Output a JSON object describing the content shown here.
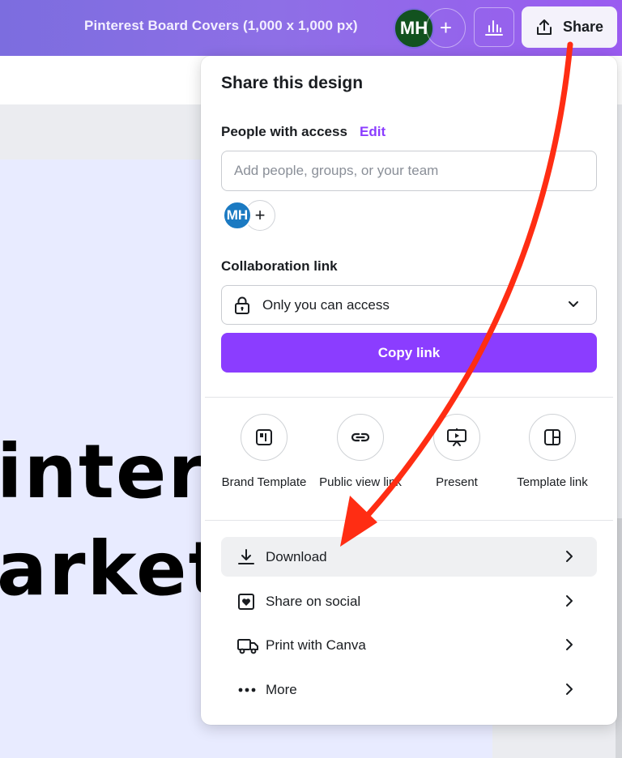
{
  "topbar": {
    "doc_title": "Pinterest Board Covers (1,000 x 1,000 px)",
    "avatar_initials": "MH",
    "add_symbol": "+",
    "share_label": "Share",
    "icons": [
      "plus-icon",
      "insights-chart-icon",
      "share-upload-icon"
    ]
  },
  "canvas": {
    "text_line_1": "intere",
    "text_line_2": "arket"
  },
  "share_panel": {
    "title": "Share this design",
    "people_label": "People with access",
    "edit_label": "Edit",
    "people_placeholder": "Add people, groups, or your team",
    "member_initials": "MH",
    "add_member_symbol": "+",
    "collab_label": "Collaboration link",
    "access_value": "Only you can access",
    "copy_label": "Copy link",
    "options": [
      {
        "label": "Brand Template",
        "icon": "brand-template-icon"
      },
      {
        "label": "Public view link",
        "icon": "link-icon"
      },
      {
        "label": "Present",
        "icon": "present-icon"
      },
      {
        "label": "Template link",
        "icon": "template-link-icon"
      }
    ],
    "rows": [
      {
        "label": "Download",
        "icon": "download-icon"
      },
      {
        "label": "Share on social",
        "icon": "heart-icon"
      },
      {
        "label": "Print with Canva",
        "icon": "truck-icon"
      },
      {
        "label": "More",
        "icon": "more-dots-icon"
      }
    ]
  },
  "colors": {
    "brand_purple": "#8b3dff",
    "annotation_arrow": "#ff2d13",
    "topbar_gradient_start": "#7c6ddf",
    "topbar_gradient_end": "#9a5bf0"
  }
}
